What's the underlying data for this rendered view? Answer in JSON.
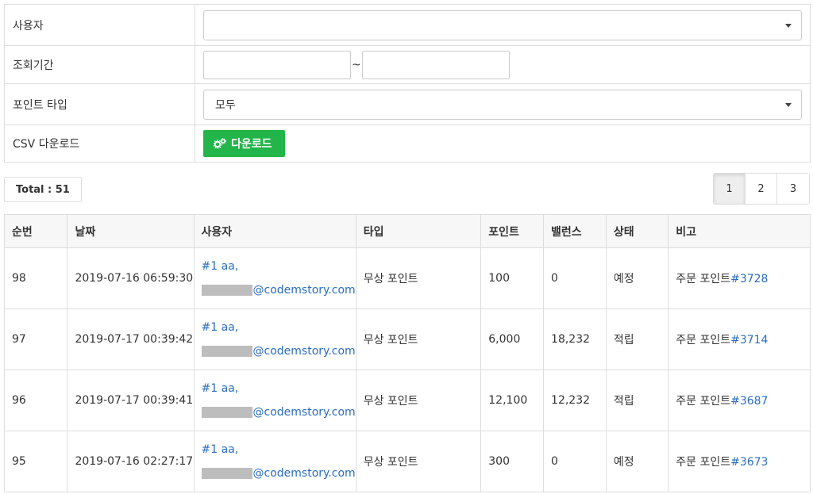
{
  "filter": {
    "user_label": "사용자",
    "user_value": "",
    "period_label": "조회기간",
    "date_from": "",
    "date_separator": "~",
    "date_to": "",
    "point_type_label": "포인트 타입",
    "point_type_value": "모두",
    "csv_label": "CSV 다운로드",
    "download_button": "다운로드"
  },
  "total_label": "Total : 51",
  "pagination": {
    "pages": [
      "1",
      "2",
      "3"
    ],
    "active": "1"
  },
  "table": {
    "headers": [
      "순번",
      "날짜",
      "사용자",
      "타입",
      "포인트",
      "밸런스",
      "상태",
      "비고"
    ],
    "rows": [
      {
        "no": "98",
        "date": "2019-07-16 06:59:30",
        "user_name": "#1 aa,",
        "user_email_domain": "@codemstory.com",
        "type": "무상 포인트",
        "point": "100",
        "balance": "0",
        "status": "예정",
        "note_prefix": "주문 포인트",
        "note_link": "#3728"
      },
      {
        "no": "97",
        "date": "2019-07-17 00:39:42",
        "user_name": "#1 aa,",
        "user_email_domain": "@codemstory.com",
        "type": "무상 포인트",
        "point": "6,000",
        "balance": "18,232",
        "status": "적립",
        "note_prefix": "주문 포인트",
        "note_link": "#3714"
      },
      {
        "no": "96",
        "date": "2019-07-17 00:39:41",
        "user_name": "#1 aa,",
        "user_email_domain": "@codemstory.com",
        "type": "무상 포인트",
        "point": "12,100",
        "balance": "12,232",
        "status": "적립",
        "note_prefix": "주문 포인트",
        "note_link": "#3687"
      },
      {
        "no": "95",
        "date": "2019-07-16 02:27:17",
        "user_name": "#1 aa,",
        "user_email_domain": "@codemstory.com",
        "type": "무상 포인트",
        "point": "300",
        "balance": "0",
        "status": "예정",
        "note_prefix": "주문 포인트",
        "note_link": "#3673"
      }
    ]
  },
  "colors": {
    "accent_green": "#22b54a",
    "link_blue": "#2a6dbf"
  },
  "icons": {
    "download_button_icon": "gears-icon",
    "select_caret": "caret-down-icon"
  }
}
